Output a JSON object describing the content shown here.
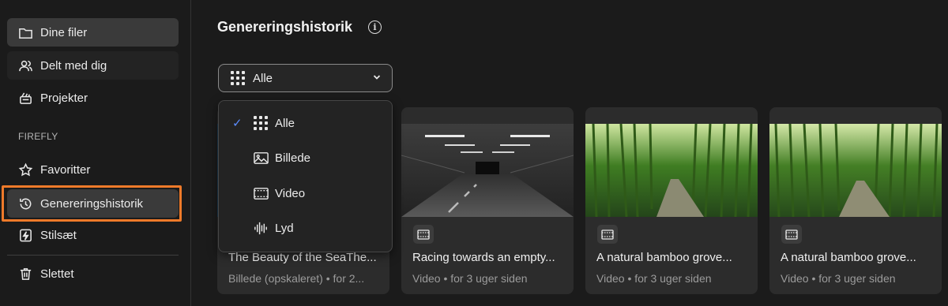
{
  "sidebar": {
    "items": [
      {
        "label": "Dine filer",
        "icon": "folder-icon"
      },
      {
        "label": "Delt med dig",
        "icon": "users-icon"
      },
      {
        "label": "Projekter",
        "icon": "projects-icon"
      },
      {
        "label": "Favoritter",
        "icon": "star-icon"
      },
      {
        "label": "Genereringshistorik",
        "icon": "history-icon"
      },
      {
        "label": "Stilsæt",
        "icon": "style-kit-icon"
      },
      {
        "label": "Slettet",
        "icon": "trash-icon"
      }
    ],
    "section_label": "FIREFLY"
  },
  "main": {
    "title": "Genereringshistorik",
    "filter": {
      "selected": "Alle",
      "options": [
        "Alle",
        "Billede",
        "Video",
        "Lyd"
      ]
    },
    "cards": [
      {
        "title": "The Beauty of the SeaThe...",
        "meta": "Billede (opskaleret) • for 2...",
        "type": "image"
      },
      {
        "title": "Racing towards an empty...",
        "meta": "Video • for 3 uger siden",
        "type": "video"
      },
      {
        "title": "A natural bamboo grove...",
        "meta": "Video • for 3 uger siden",
        "type": "video"
      },
      {
        "title": "A natural bamboo grove...",
        "meta": "Video • for 3 uger siden",
        "type": "video"
      }
    ]
  },
  "colors": {
    "accent_highlight": "#ef7a2a",
    "check": "#5c8dff",
    "background": "#1b1b1b"
  }
}
